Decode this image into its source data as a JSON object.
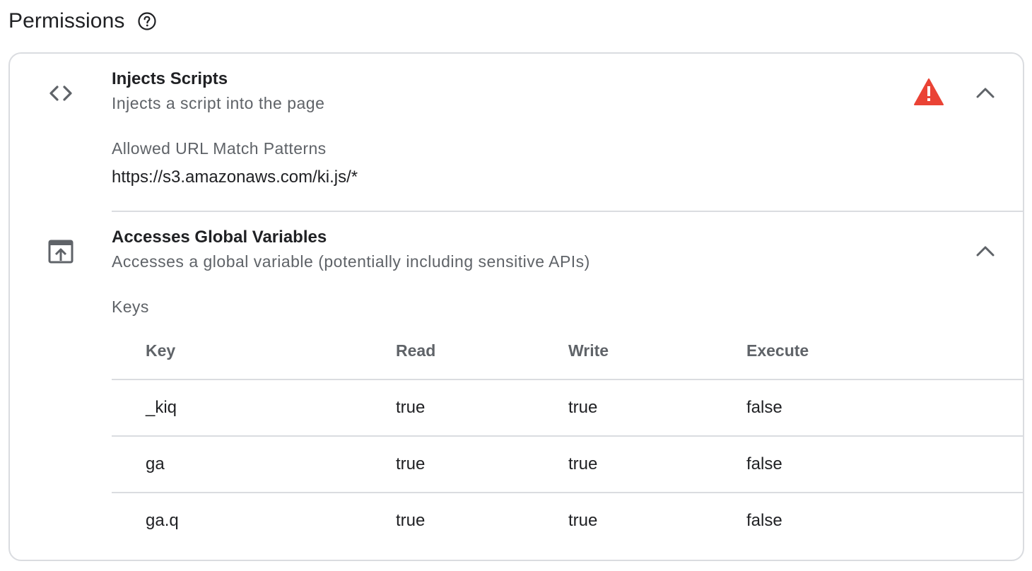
{
  "page": {
    "title": "Permissions",
    "help_icon": "help-circle-icon"
  },
  "permissions": [
    {
      "icon": "code-icon",
      "title": "Injects Scripts",
      "description": "Injects a script into the page",
      "warning_icon": "warning-triangle-icon",
      "warning_color": "#ea4335",
      "collapse_icon": "chevron-up-icon",
      "field_label": "Allowed URL Match Patterns",
      "field_value": "https://s3.amazonaws.com/ki.js/*"
    },
    {
      "icon": "open-in-window-icon",
      "title": "Accesses Global Variables",
      "description": "Accesses a global variable (potentially including sensitive APIs)",
      "collapse_icon": "chevron-up-icon",
      "field_label": "Keys",
      "table": {
        "headers": {
          "key": "Key",
          "read": "Read",
          "write": "Write",
          "execute": "Execute"
        },
        "rows": [
          {
            "key": "_kiq",
            "read": "true",
            "write": "true",
            "execute": "false"
          },
          {
            "key": "ga",
            "read": "true",
            "write": "true",
            "execute": "false"
          },
          {
            "key": "ga.q",
            "read": "true",
            "write": "true",
            "execute": "false"
          }
        ]
      }
    }
  ],
  "colors": {
    "text_primary": "#202124",
    "text_secondary": "#5f6368",
    "border": "#dadce0",
    "warning": "#ea4335"
  }
}
